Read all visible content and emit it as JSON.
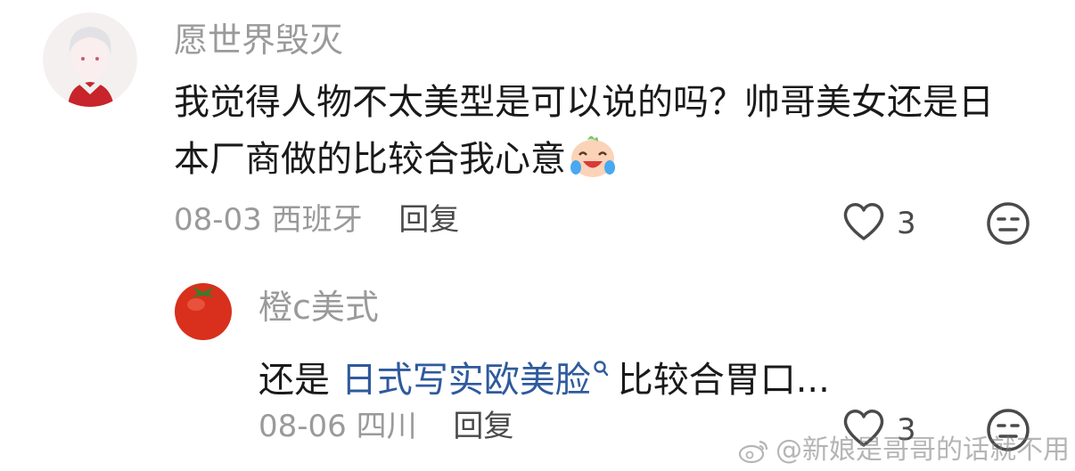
{
  "comments": [
    {
      "username": "愿世界毁灭",
      "text_line1": "我觉得人物不太美型是可以说的吗？帅哥美女还是日",
      "text_line2": "本厂商做的比较合我心意",
      "emoji": "laughing-crying-emoji",
      "date": "08-03",
      "location": "西班牙",
      "reply_label": "回复",
      "like_count": "3"
    },
    {
      "username": "橙c美式",
      "text_before_link": "还是 ",
      "link_text": "日式写实欧美脸",
      "text_after_link": "比较合胃口...",
      "date": "08-06",
      "location": "四川",
      "reply_label": "回复",
      "like_count": "3"
    }
  ],
  "watermark": "@新娘是哥哥的话就不用"
}
